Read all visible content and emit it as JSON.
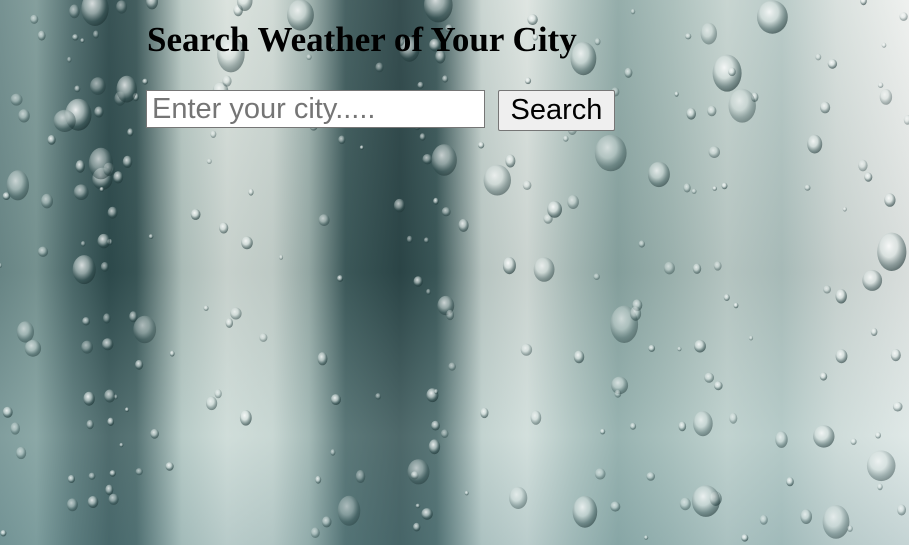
{
  "page": {
    "title": "Search Weather of Your City"
  },
  "search": {
    "placeholder": "Enter your city.....",
    "value": "",
    "button_label": "Search"
  },
  "background": {
    "description_icon": "rain-drops-window-background",
    "colors": {
      "teal_dark": "#2e4a4c",
      "teal_mid": "#7e9a98",
      "light": "#dde4e0"
    }
  }
}
